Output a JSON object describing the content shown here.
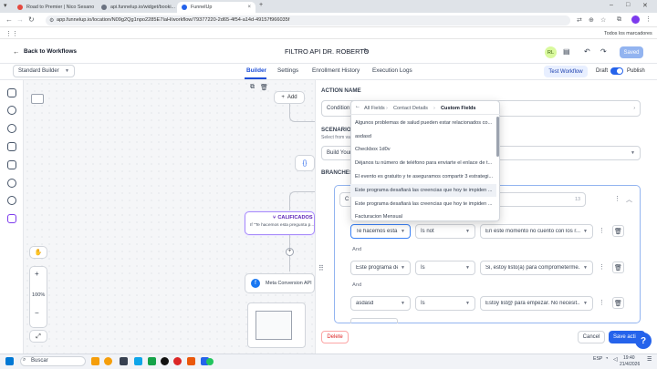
{
  "browser": {
    "tabs": [
      {
        "label": "Road to Premier | Nico Sesano"
      },
      {
        "label": "api.funnelup.io/widget/booki..."
      },
      {
        "label": "FunnelUp"
      }
    ],
    "url": "app.funnelup.io/location/N09g2Qg1npo2285E7IaH/workflow/79377220-2d65-4f54-a14d-49157f966035f",
    "bookmarks_label": "Todos los marcadores"
  },
  "header": {
    "back_label": "Back to Workflows",
    "title": "FILTRO API DR. ROBERTO",
    "avatar_initials": "RL",
    "saved_label": "Saved"
  },
  "nav": {
    "builder_select": "Standard Builder",
    "tabs": [
      "Builder",
      "Settings",
      "Enrollment History",
      "Execution Logs"
    ],
    "active_tab": "Builder",
    "test_label": "Test Workflow",
    "draft_label": "Draft",
    "publish_label": "Publish"
  },
  "canvas": {
    "add_label": "Add",
    "zoom_label": "100%",
    "calificados_label": "CALIFICADOS",
    "calificados_desc": "If \"Te hacemos esta pregunta p...",
    "meta_node_label": "Meta Conversion API"
  },
  "panel": {
    "action_name_label": "ACTION NAME",
    "action_name_value": "Condition",
    "scenario_label": "SCENARIO",
    "scenario_hint": "Select from va",
    "scenario_value": "Build Your",
    "branches_label": "BRANCHES",
    "branch_name_partial": "C",
    "branch_counter": "13",
    "rows": [
      {
        "field": "Te hacemos esta p",
        "op": "Is not",
        "value": "En este momento no cuento con los r..."
      },
      {
        "field": "Este programa de",
        "op": "Is",
        "value": "Si, estoy listo(a) para comprometerme..."
      },
      {
        "field": "asdasd",
        "op": "Is",
        "value": "Estoy list@ para empezar. No necesit..."
      }
    ],
    "and_label": "And",
    "delete_label": "Delete",
    "cancel_label": "Cancel",
    "save_label": "Save acti"
  },
  "popup": {
    "breadcrumb": [
      "All Fields",
      "Contact Details",
      "Custom Fields"
    ],
    "options": [
      "Algunos problemas de salud pueden estar relacionados co...",
      "asdasd",
      "Checkbox 1d0v",
      "Déjanos tu número de teléfono para enviarte el enlace de t...",
      "El evento es gratuito y te aseguramos compartir 3 estrategi...",
      "Este programa desafiará las creencias que hoy te impiden ...",
      "Este programa desafiará las creencias que hoy te impiden ...",
      "Facturacion Mensual"
    ],
    "highlighted_index": 5
  },
  "taskbar": {
    "search_label": "Buscar",
    "time": "19:40",
    "date": "21/4/2026",
    "lang": "ESP"
  },
  "help_label": "?"
}
